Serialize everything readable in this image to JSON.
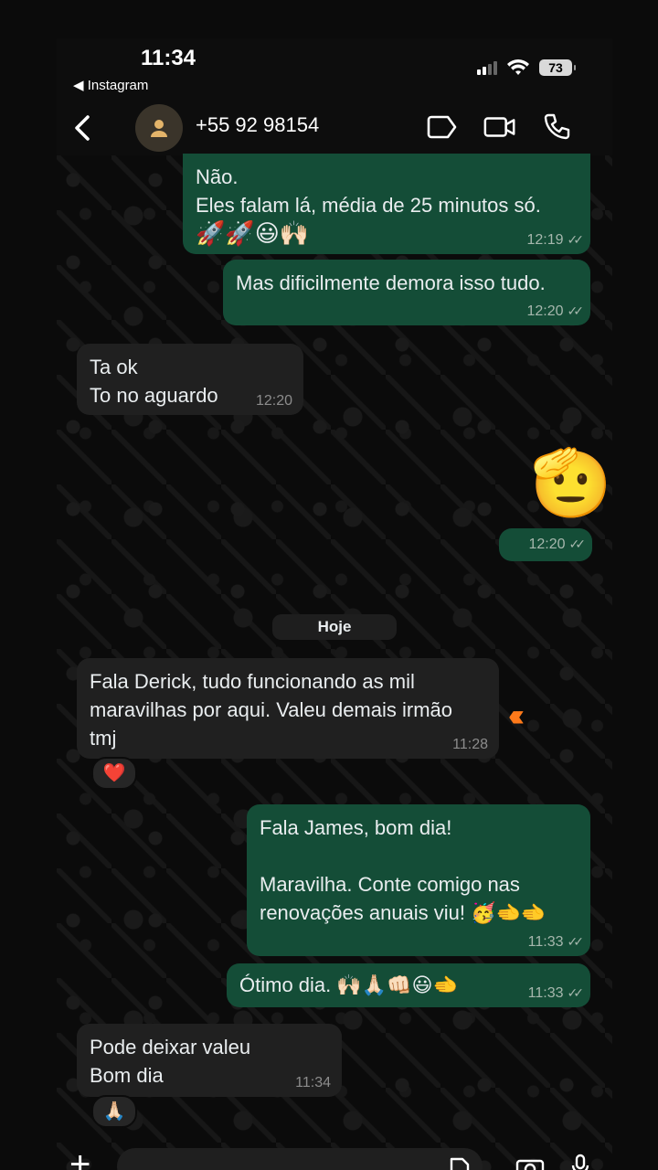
{
  "status_bar": {
    "time": "11:34",
    "back_app": "◀ Instagram",
    "battery": "73"
  },
  "header": {
    "contact": "+55 92 98154"
  },
  "messages": [
    {
      "dir": "out",
      "lines": [
        "Não.",
        "Eles falam lá, média de 25 minutos só."
      ],
      "emoji": "🚀🚀😃🙌🏻",
      "time": "12:19"
    },
    {
      "dir": "out",
      "lines": [
        "Mas dificilmente demora isso tudo."
      ],
      "time": "12:20"
    },
    {
      "dir": "in",
      "lines": [
        "Ta ok",
        "To no aguardo"
      ],
      "time": "12:20"
    },
    {
      "dir": "out",
      "sticker": "🫡",
      "time": "12:20"
    },
    {
      "dir": "in",
      "lines": [
        "Fala Derick, tudo funcionando as mil",
        "maravilhas por aqui. Valeu demais irmão",
        "tmj"
      ],
      "time": "11:28",
      "reaction": "❤️"
    },
    {
      "dir": "out",
      "lines": [
        "Fala James, bom dia!",
        "",
        "Maravilha. Conte comigo nas",
        "renovações anuais viu! 🥳🫲🫲"
      ],
      "time": "11:33"
    },
    {
      "dir": "out",
      "lines": [
        "Ótimo dia. 🙌🏻🙏🏻👊🏻😃🫲"
      ],
      "time": "11:33"
    },
    {
      "dir": "in",
      "lines": [
        "Pode deixar valeu",
        "Bom dia"
      ],
      "time": "11:34",
      "reaction": "🙏🏻"
    }
  ],
  "date_divider": "Hoje",
  "colors": {
    "outgoing": "#144d37",
    "incoming": "#202020",
    "accent_chevron": "#ff7a1a"
  }
}
